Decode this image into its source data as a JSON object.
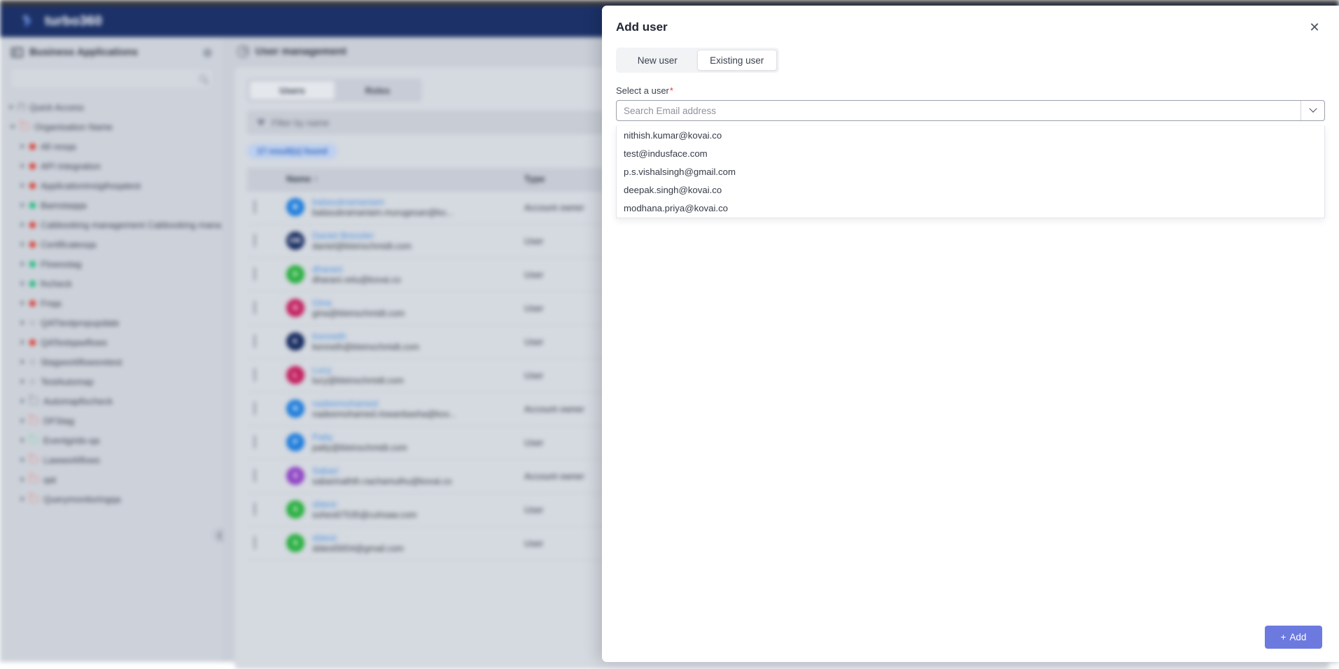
{
  "brand": {
    "name": "turbo360",
    "logo_icon": "turbo-bird-logo-icon"
  },
  "sidebar": {
    "title": "Business Applications",
    "gear_icon": "gear-icon",
    "search_placeholder": "",
    "search_icon": "search-icon",
    "collapse_icon": "chevron-left-icon",
    "items": [
      {
        "label": "Quick Access",
        "icon": "bookmark-icon",
        "level": 0,
        "expanded": false,
        "status": ""
      },
      {
        "label": "Organisation Name",
        "icon": "folder-icon",
        "level": 0,
        "expanded": true,
        "status": "red"
      },
      {
        "label": "All resqa",
        "icon": "status-dot-icon",
        "level": 1,
        "expanded": false,
        "status": "red"
      },
      {
        "label": "API Integration",
        "icon": "status-dot-icon",
        "level": 1,
        "expanded": false,
        "status": "red"
      },
      {
        "label": "Applicationinsigthsqatest",
        "icon": "status-dot-icon",
        "level": 1,
        "expanded": false,
        "status": "red"
      },
      {
        "label": "Bamstaqqa",
        "icon": "status-dot-icon",
        "level": 1,
        "expanded": false,
        "status": "green"
      },
      {
        "label": "Cabbooking management Cabbooking mana",
        "icon": "status-dot-icon",
        "level": 1,
        "expanded": false,
        "status": "red"
      },
      {
        "label": "Certificatesqa",
        "icon": "status-dot-icon",
        "level": 1,
        "expanded": false,
        "status": "red"
      },
      {
        "label": "Flowsstag",
        "icon": "status-dot-icon",
        "level": 1,
        "expanded": false,
        "status": "green"
      },
      {
        "label": "fncheck",
        "icon": "status-dot-icon",
        "level": 1,
        "expanded": false,
        "status": "green"
      },
      {
        "label": "Fnqa",
        "icon": "status-dot-icon",
        "level": 1,
        "expanded": false,
        "status": "red"
      },
      {
        "label": "QATtestpropupdate",
        "icon": "status-dot-icon",
        "level": 1,
        "expanded": false,
        "status": "grey"
      },
      {
        "label": "QATestqawflows",
        "icon": "status-dot-icon",
        "level": 1,
        "expanded": false,
        "status": "red"
      },
      {
        "label": "Stagworkflowsretest",
        "icon": "status-dot-icon",
        "level": 1,
        "expanded": false,
        "status": "grey"
      },
      {
        "label": "TestAutomap",
        "icon": "status-dot-icon",
        "level": 1,
        "expanded": false,
        "status": "grey"
      },
      {
        "label": "Automapfixcheck",
        "icon": "folder-icon",
        "level": 1,
        "expanded": false,
        "status": "grey"
      },
      {
        "label": "DFStag",
        "icon": "folder-icon",
        "level": 1,
        "expanded": false,
        "status": "red"
      },
      {
        "label": "Eventgrids-qa",
        "icon": "folder-icon",
        "level": 1,
        "expanded": false,
        "status": "green"
      },
      {
        "label": "Lawworkflows",
        "icon": "folder-icon",
        "level": 1,
        "expanded": false,
        "status": "red"
      },
      {
        "label": "qat",
        "icon": "folder-icon",
        "level": 1,
        "expanded": false,
        "status": "red"
      },
      {
        "label": "Querymonitoringqa",
        "icon": "folder-icon",
        "level": 1,
        "expanded": false,
        "status": "red"
      }
    ]
  },
  "main": {
    "page_title": "User management",
    "page_icon": "user-management-icon",
    "tabs": [
      {
        "label": "Users",
        "active": true
      },
      {
        "label": "Roles",
        "active": false
      }
    ],
    "filter_placeholder": "Filter by name",
    "filter_icon": "funnel-icon",
    "result_count": "17 result(s) found",
    "columns": [
      "",
      "Name",
      "Type"
    ],
    "sort_icon": "sort-arrow-icon",
    "rows": [
      {
        "name": "balasubramaniam",
        "email": "balasubramaniam.murugesan@ko...",
        "type": "Account owner",
        "initial": "B",
        "color": "#1f7ddb"
      },
      {
        "name": "Daniel Bressler",
        "email": "daniel@kleinschmidt.com",
        "type": "User",
        "initial": "DB",
        "color": "#15295e"
      },
      {
        "name": "dharani",
        "email": "dharani.velu@kovai.co",
        "type": "User",
        "initial": "D",
        "color": "#28af3f"
      },
      {
        "name": "Gina",
        "email": "gina@kleinschmidt.com",
        "type": "User",
        "initial": "G",
        "color": "#c32160"
      },
      {
        "name": "Kenneth",
        "email": "kenneth@kleinschmidt.com",
        "type": "User",
        "initial": "K",
        "color": "#15295e"
      },
      {
        "name": "Lucy",
        "email": "lucy@kleinschmidt.com",
        "type": "User",
        "initial": "L",
        "color": "#c32160"
      },
      {
        "name": "nadeemohamed",
        "email": "nadeemohamed.riswanbasha@kov...",
        "type": "Account owner",
        "initial": "N",
        "color": "#1f7ddb"
      },
      {
        "name": "Patty",
        "email": "patty@kleinschmidt.com",
        "type": "User",
        "initial": "P",
        "color": "#1f7ddb"
      },
      {
        "name": "Sabari",
        "email": "sabarinathth.nachamuthu@kovai.co",
        "type": "Account owner",
        "initial": "S",
        "color": "#8e44c4"
      },
      {
        "name": "sbtest",
        "email": "sohes67535@cuhsaw.com",
        "type": "User",
        "initial": "S",
        "color": "#28af3f"
      },
      {
        "name": "sbtest",
        "email": "sbtest5654@gmail.com",
        "type": "User",
        "initial": "S",
        "color": "#28af3f"
      }
    ]
  },
  "modal": {
    "title": "Add user",
    "close_icon": "close-icon",
    "tabs": [
      {
        "label": "New user",
        "active": false
      },
      {
        "label": "Existing user",
        "active": true
      }
    ],
    "field_label": "Select a user",
    "required_marker": "*",
    "search_value": "",
    "search_placeholder": "Search Email address",
    "dropdown_icon": "chevron-down-icon",
    "dropdown_options": [
      "nithish.kumar@kovai.co",
      "test@indusface.com",
      "p.s.vishalsingh@gmail.com",
      "deepak.singh@kovai.co",
      "modhana.priya@kovai.co"
    ],
    "add_button_label": "Add",
    "add_button_icon": "plus-icon",
    "accent_color": "#6c7ae0"
  }
}
